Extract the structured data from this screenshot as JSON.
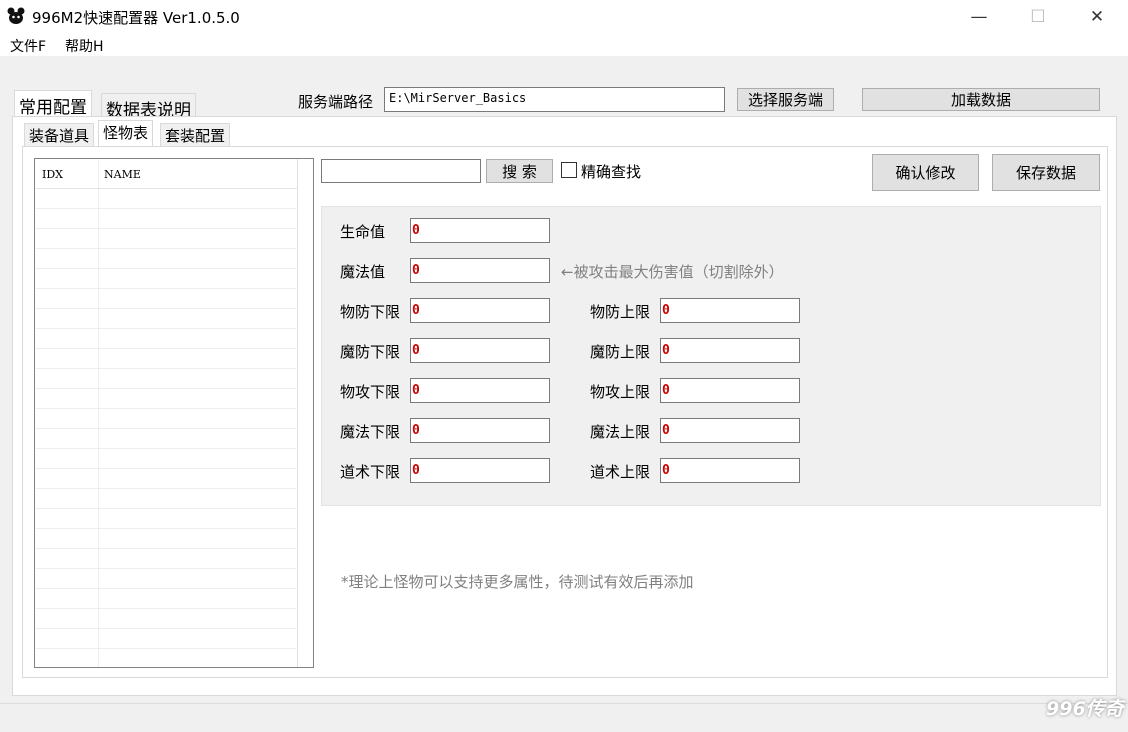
{
  "window": {
    "title": "996M2快速配置器 Ver1.0.5.0",
    "minimize_glyph": "—",
    "maximize_glyph": "☐",
    "close_glyph": "✕"
  },
  "menu": [
    "文件F",
    "帮助H"
  ],
  "outer_tabs": [
    "常用配置",
    "数据表说明"
  ],
  "server": {
    "path_label": "服务端路径",
    "path_value": "E:\\MirServer_Basics",
    "select_button": "选择服务端",
    "load_button": "加载数据"
  },
  "inner_tabs": [
    "装备道具",
    "怪物表",
    "套装配置"
  ],
  "list": {
    "columns": [
      "IDX",
      "NAME"
    ]
  },
  "search": {
    "value": "",
    "button": "搜  索",
    "exact_label": "精确查找",
    "exact_checked": false
  },
  "actions": {
    "confirm": "确认修改",
    "save": "保存数据"
  },
  "fields": {
    "hp": {
      "label": "生命值",
      "value": "0"
    },
    "mp": {
      "label": "魔法值",
      "value": "0"
    },
    "mp_hint": "←被攻击最大伤害值（切割除外）",
    "ac_min": {
      "label": "物防下限",
      "value": "0"
    },
    "ac_max": {
      "label": "物防上限",
      "value": "0"
    },
    "mac_min": {
      "label": "魔防下限",
      "value": "0"
    },
    "mac_max": {
      "label": "魔防上限",
      "value": "0"
    },
    "dc_min": {
      "label": "物攻下限",
      "value": "0"
    },
    "dc_max": {
      "label": "物攻上限",
      "value": "0"
    },
    "mc_min": {
      "label": "魔法下限",
      "value": "0"
    },
    "mc_max": {
      "label": "魔法上限",
      "value": "0"
    },
    "sc_min": {
      "label": "道术下限",
      "value": "0"
    },
    "sc_max": {
      "label": "道术上限",
      "value": "0"
    }
  },
  "note": "*理论上怪物可以支持更多属性，待测试有效后再添加",
  "watermark": "996传奇",
  "colors": {
    "field_value": "#cc0000",
    "hint": "#808080"
  }
}
